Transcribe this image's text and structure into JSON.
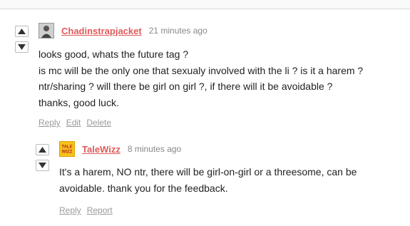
{
  "comments": [
    {
      "author": "Chadinstrapjacket",
      "time": "21 minutes ago",
      "lines": [
        "looks good, whats the future tag ?",
        "is mc will be the only one that sexualy involved with the li ? is it a harem ?",
        "ntr/sharing ? will there be girl on girl ?, if there will it be avoidable ?",
        "thanks, good luck."
      ],
      "actions": {
        "reply": "Reply",
        "edit": "Edit",
        "delete": "Delete"
      }
    },
    {
      "author": "TaleWizz",
      "time": "8 minutes ago",
      "avatar_text": [
        "TALE",
        "WIZZ"
      ],
      "lines": [
        "It's a harem, NO ntr, there will be girl-on-girl or a threesome, can be",
        "avoidable. thank you for the feedback."
      ],
      "actions": {
        "reply": "Reply",
        "report": "Report"
      }
    }
  ],
  "colors": {
    "author": "#e05a5a",
    "meta": "#888888",
    "action": "#9a9a9a",
    "avatar_yellow": "#f6c21a"
  },
  "icons": [
    "upvote-icon",
    "downvote-icon"
  ]
}
